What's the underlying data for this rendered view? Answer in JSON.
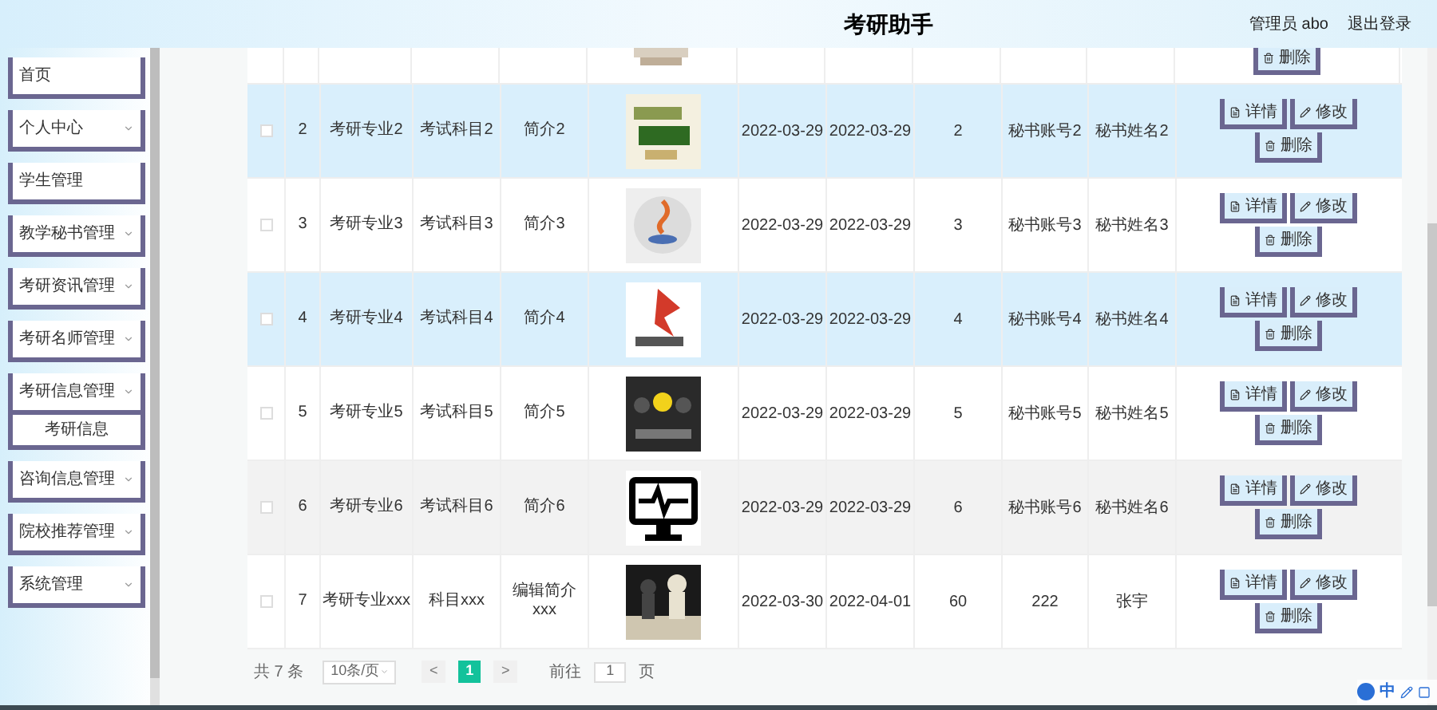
{
  "header": {
    "title": "考研助手",
    "user": "管理员 abo",
    "logout": "退出登录"
  },
  "sidebar": {
    "items": [
      {
        "label": "首页",
        "has_arrow": false
      },
      {
        "label": "个人中心",
        "has_arrow": true
      },
      {
        "label": "学生管理",
        "has_arrow": false
      },
      {
        "label": "教学秘书管理",
        "has_arrow": true
      },
      {
        "label": "考研资讯管理",
        "has_arrow": true
      },
      {
        "label": "考研名师管理",
        "has_arrow": true
      },
      {
        "label": "考研信息管理",
        "has_arrow": true,
        "children": [
          {
            "label": "考研信息"
          }
        ]
      },
      {
        "label": "咨询信息管理",
        "has_arrow": true
      },
      {
        "label": "院校推荐管理",
        "has_arrow": true
      },
      {
        "label": "系统管理",
        "has_arrow": true
      }
    ]
  },
  "table": {
    "partial_row": {
      "actions": [
        "删除"
      ]
    },
    "rows": [
      {
        "checked": false,
        "selected": true,
        "hovered": false,
        "cells": [
          "2",
          "考研专业2",
          "考试科目2",
          "简介2",
          "2022-03-29",
          "2022-03-29",
          "2",
          "秘书账号2",
          "秘书姓名2"
        ],
        "actions": [
          "详情",
          "修改",
          "删除"
        ]
      },
      {
        "checked": false,
        "selected": false,
        "hovered": false,
        "cells": [
          "3",
          "考研专业3",
          "考试科目3",
          "简介3",
          "2022-03-29",
          "2022-03-29",
          "3",
          "秘书账号3",
          "秘书姓名3"
        ],
        "actions": [
          "详情",
          "修改",
          "删除"
        ]
      },
      {
        "checked": false,
        "selected": true,
        "hovered": false,
        "cells": [
          "4",
          "考研专业4",
          "考试科目4",
          "简介4",
          "2022-03-29",
          "2022-03-29",
          "4",
          "秘书账号4",
          "秘书姓名4"
        ],
        "actions": [
          "详情",
          "修改",
          "删除"
        ]
      },
      {
        "checked": false,
        "selected": false,
        "hovered": false,
        "cells": [
          "5",
          "考研专业5",
          "考试科目5",
          "简介5",
          "2022-03-29",
          "2022-03-29",
          "5",
          "秘书账号5",
          "秘书姓名5"
        ],
        "actions": [
          "详情",
          "修改",
          "删除"
        ]
      },
      {
        "checked": false,
        "selected": false,
        "hovered": true,
        "cells": [
          "6",
          "考研专业6",
          "考试科目6",
          "简介6",
          "2022-03-29",
          "2022-03-29",
          "6",
          "秘书账号6",
          "秘书姓名6"
        ],
        "actions": [
          "详情",
          "修改",
          "删除"
        ]
      },
      {
        "checked": false,
        "selected": false,
        "hovered": false,
        "cells": [
          "7",
          "考研专业xxx",
          "科目xxx",
          "编辑简介xxx",
          "2022-03-30",
          "2022-04-01",
          "60",
          "222",
          "张宇"
        ],
        "actions": [
          "详情",
          "修改",
          "删除"
        ]
      }
    ]
  },
  "pagination": {
    "total": "共 7 条",
    "page_size": "10条/页",
    "prev": "<",
    "pages": [
      {
        "label": "1",
        "selected": true
      }
    ],
    "next": ">",
    "goto_label": "前往",
    "goto_value": "1",
    "goto_suffix": "页"
  },
  "ime_toolbar": {
    "label": "中"
  }
}
